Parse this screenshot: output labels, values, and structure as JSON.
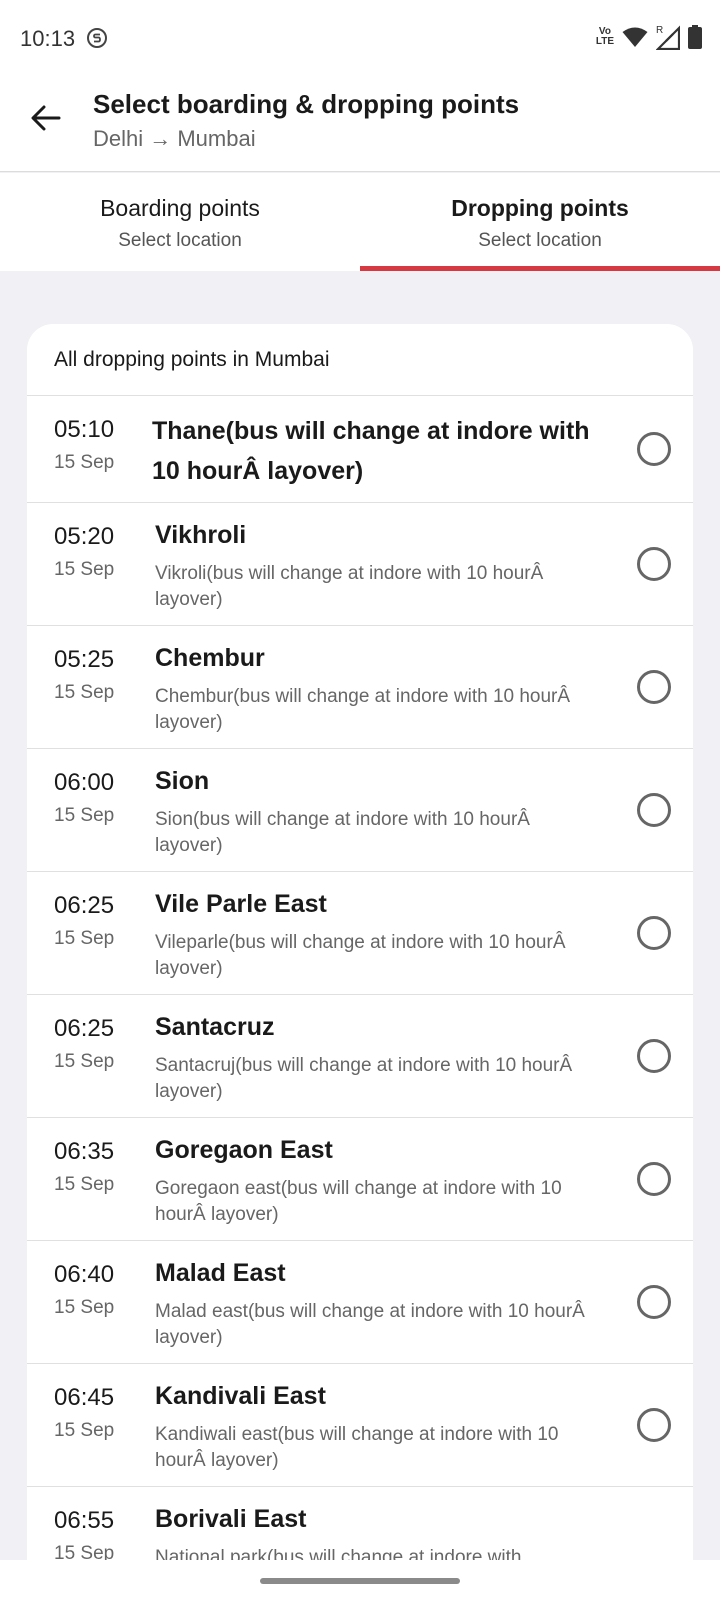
{
  "status_bar": {
    "time": "10:13",
    "volte_top": "Vo",
    "volte_bottom": "LTE",
    "signal_roaming": "R"
  },
  "header": {
    "title": "Select boarding & dropping points",
    "subtitle": "Delhi → Mumbai"
  },
  "tabs": [
    {
      "label": "Boarding points",
      "sublabel": "Select location",
      "active": false
    },
    {
      "label": "Dropping points",
      "sublabel": "Select location",
      "active": true
    }
  ],
  "list": {
    "heading": "All dropping points in Mumbai",
    "items": [
      {
        "time": "05:10",
        "date": "15 Sep",
        "name": "Thane(bus will change at indore with 10 hourÂ layover)",
        "desc": ""
      },
      {
        "time": "05:20",
        "date": "15 Sep",
        "name": "Vikhroli",
        "desc": "Vikroli(bus will change at indore with 10 hourÂ layover)"
      },
      {
        "time": "05:25",
        "date": "15 Sep",
        "name": "Chembur",
        "desc": "Chembur(bus will change at indore with 10 hourÂ layover)"
      },
      {
        "time": "06:00",
        "date": "15 Sep",
        "name": "Sion",
        "desc": "Sion(bus will change at indore with 10 hourÂ layover)"
      },
      {
        "time": "06:25",
        "date": "15 Sep",
        "name": "Vile Parle East",
        "desc": "Vileparle(bus will change at indore with 10 hourÂ layover)"
      },
      {
        "time": "06:25",
        "date": "15 Sep",
        "name": "Santacruz",
        "desc": "Santacruj(bus will change at indore with 10 hourÂ layover)"
      },
      {
        "time": "06:35",
        "date": "15 Sep",
        "name": "Goregaon East",
        "desc": "Goregaon east(bus will change at indore with 10 hourÂ layover)"
      },
      {
        "time": "06:40",
        "date": "15 Sep",
        "name": "Malad East",
        "desc": "Malad east(bus will change at indore with 10 hourÂ layover)"
      },
      {
        "time": "06:45",
        "date": "15 Sep",
        "name": "Kandivali East",
        "desc": "Kandiwali east(bus will change at indore with 10 hourÂ layover)"
      },
      {
        "time": "06:55",
        "date": "15 Sep",
        "name": "Borivali East",
        "desc": "National park(bus will change at indore with"
      }
    ]
  },
  "colors": {
    "accent": "#d63941",
    "background": "#f0f0f5"
  },
  "icons": {
    "back": "arrow-left-icon",
    "radio": "radio-unselected-icon"
  }
}
